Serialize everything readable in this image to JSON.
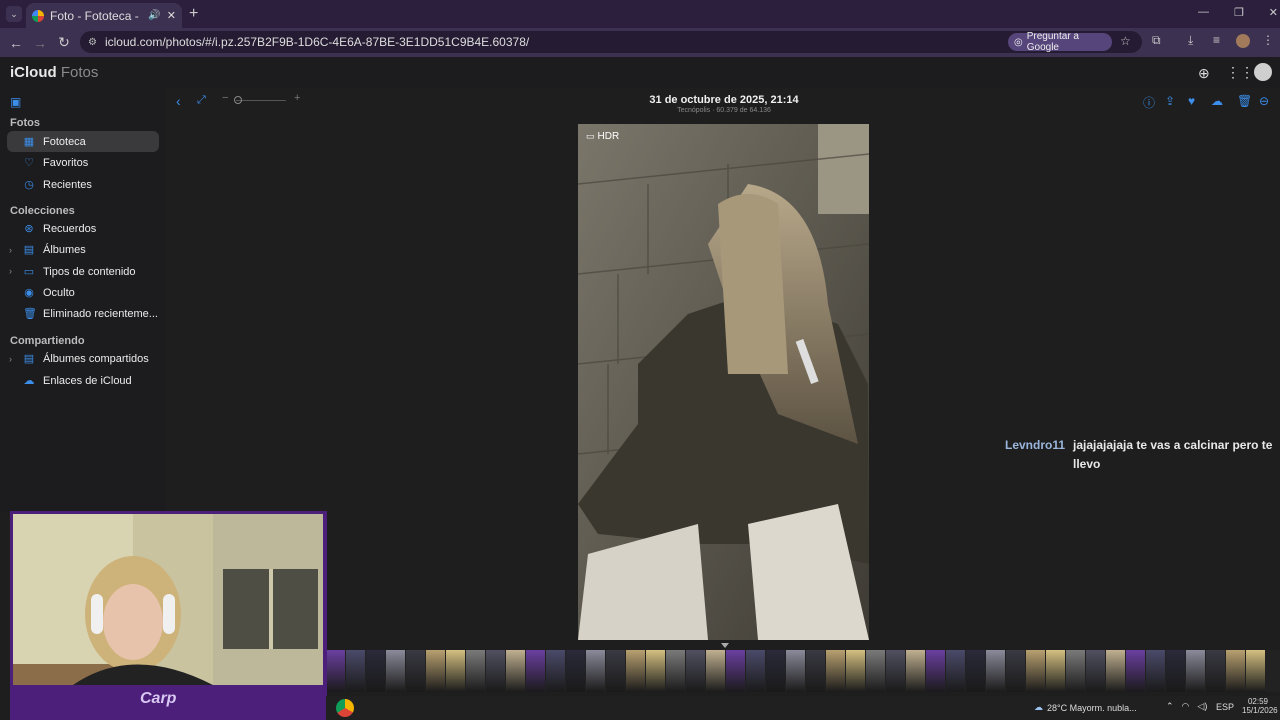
{
  "browser": {
    "tab_title": "Foto - Fototeca - Fotos en iCloud",
    "url": "icloud.com/photos/#/i.pz.257B2F9B-1D6C-4E6A-87BE-3E1DD51C9B4E.60378/",
    "ask_google": "Preguntar a Google"
  },
  "app": {
    "brand_main": "iCloud",
    "brand_sub": " Fotos"
  },
  "sidebar": {
    "section_fotos": "Fotos",
    "section_colecciones": "Colecciones",
    "section_compartiendo": "Compartiendo",
    "items": [
      {
        "label": "Fototeca"
      },
      {
        "label": "Favoritos"
      },
      {
        "label": "Recientes"
      },
      {
        "label": "Recuerdos"
      },
      {
        "label": "Álbumes"
      },
      {
        "label": "Tipos de contenido"
      },
      {
        "label": "Oculto"
      },
      {
        "label": "Eliminado recienteme..."
      },
      {
        "label": "Álbumes compartidos"
      },
      {
        "label": "Enlaces de iCloud"
      }
    ]
  },
  "photo": {
    "title": "31 de octubre de 2025, 21:14",
    "subtitle": "Tecnópolis · 60.379 de 64.136",
    "badge": "HDR"
  },
  "chat": {
    "user": "Levndro11",
    "message": "jajajajajaja te vas a calcinar pero te llevo"
  },
  "stream": {
    "logo": "Carp"
  },
  "taskbar": {
    "weather": "28°C  Mayorm. nubla...",
    "lang": "ESP",
    "time": "02:59",
    "date": "15/1/2026"
  },
  "colors": {
    "accent": "#3b8eea",
    "selected_bg": "#3a3a3c",
    "frame": "#4b1f7a"
  },
  "icons": [
    "menu-icon",
    "back-icon",
    "forward-icon",
    "reload-icon",
    "info-icon",
    "share-icon",
    "heart-icon",
    "download-icon",
    "trash-icon",
    "more-icon"
  ]
}
